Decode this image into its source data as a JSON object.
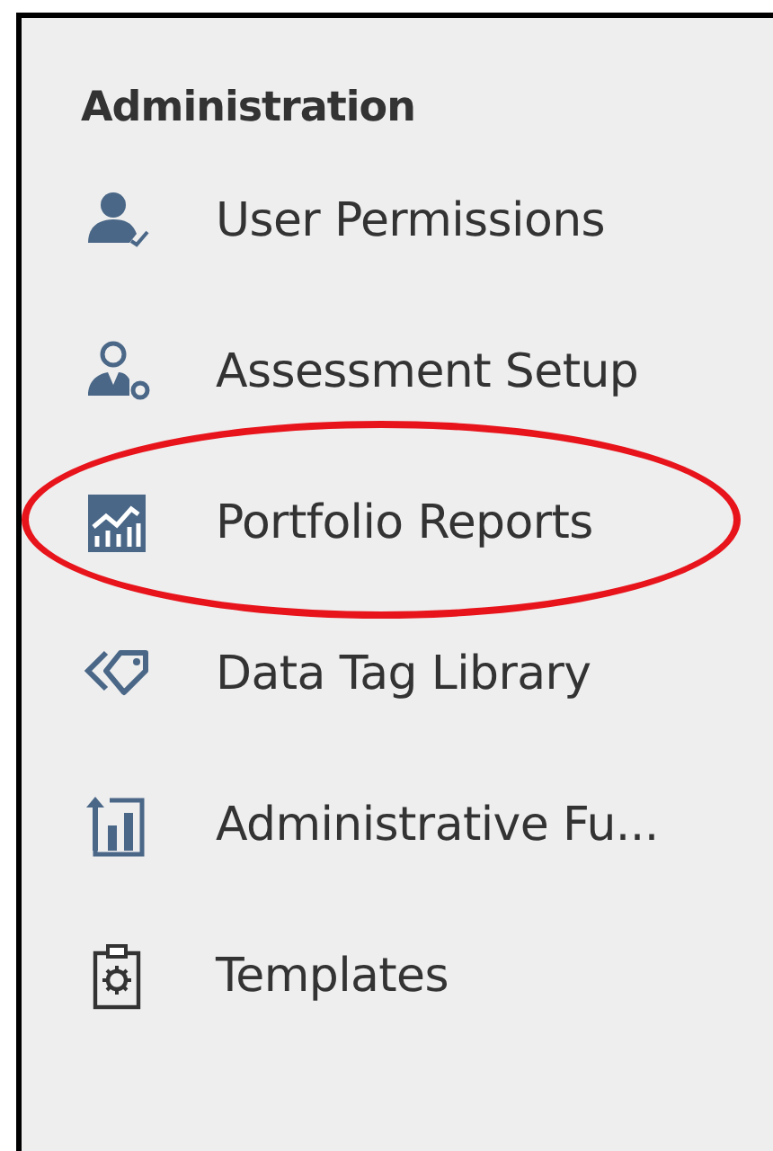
{
  "sidebar": {
    "heading": "Administration",
    "items": [
      {
        "label": "User Permissions",
        "circled": false
      },
      {
        "label": "Assessment Setup",
        "circled": false
      },
      {
        "label": "Portfolio Reports",
        "circled": true
      },
      {
        "label": "Data Tag Library",
        "circled": false
      },
      {
        "label": "Administrative Fu...",
        "circled": false
      },
      {
        "label": "Templates",
        "circled": false
      }
    ]
  }
}
